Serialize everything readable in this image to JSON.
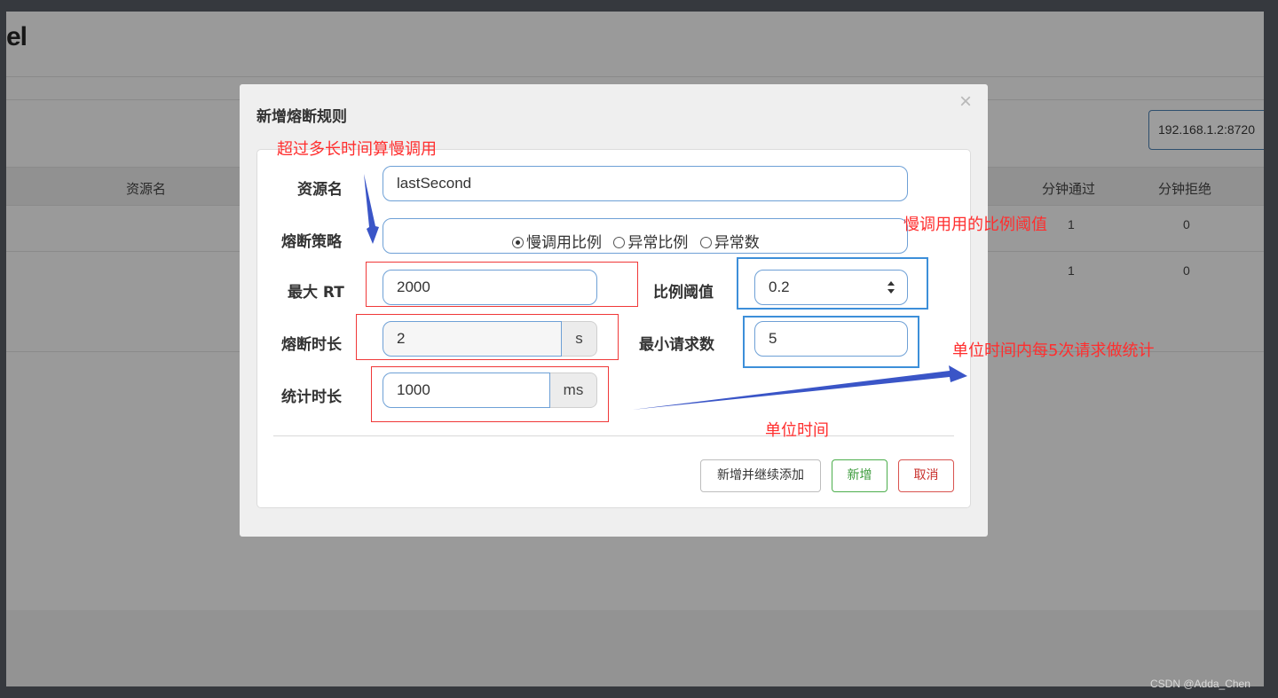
{
  "app": {
    "title_fragment": "el"
  },
  "background": {
    "ip_value": "192.168.1.2:8720",
    "table_headers": {
      "resource": "资源名",
      "pass_per_min": "分钟通过",
      "block_per_min": "分钟拒绝"
    },
    "rows": [
      {
        "pass": "1",
        "block": "0"
      },
      {
        "pass": "1",
        "block": "0"
      }
    ]
  },
  "modal": {
    "title": "新增熔断规则",
    "close_symbol": "×",
    "fields": {
      "resource_label": "资源名",
      "resource_value": "lastSecond",
      "strategy_label": "熔断策略",
      "strategy_options": [
        "慢调用比例",
        "异常比例",
        "异常数"
      ],
      "strategy_selected": "慢调用比例",
      "max_rt_label": "最大 RT",
      "max_rt_value": "2000",
      "ratio_label": "比例阈值",
      "ratio_value": "0.2",
      "duration_label": "熔断时长",
      "duration_value": "2",
      "duration_unit": "s",
      "min_request_label": "最小请求数",
      "min_request_value": "5",
      "stat_label": "统计时长",
      "stat_value": "1000",
      "stat_unit": "ms"
    },
    "buttons": {
      "add_continue": "新增并继续添加",
      "add": "新增",
      "cancel": "取消"
    }
  },
  "annotations": {
    "slow_call_time": "超过多长时间算慢调用",
    "slow_ratio": "慢调用用的比例阈值",
    "per_unit_time": "单位时间内每5次请求做统计",
    "unit_time": "单位时间",
    "arrow_color": "#3a55c7",
    "box_red": "#f03838",
    "box_blue": "#3d8fd9"
  },
  "watermark": "CSDN @Adda_Chen"
}
